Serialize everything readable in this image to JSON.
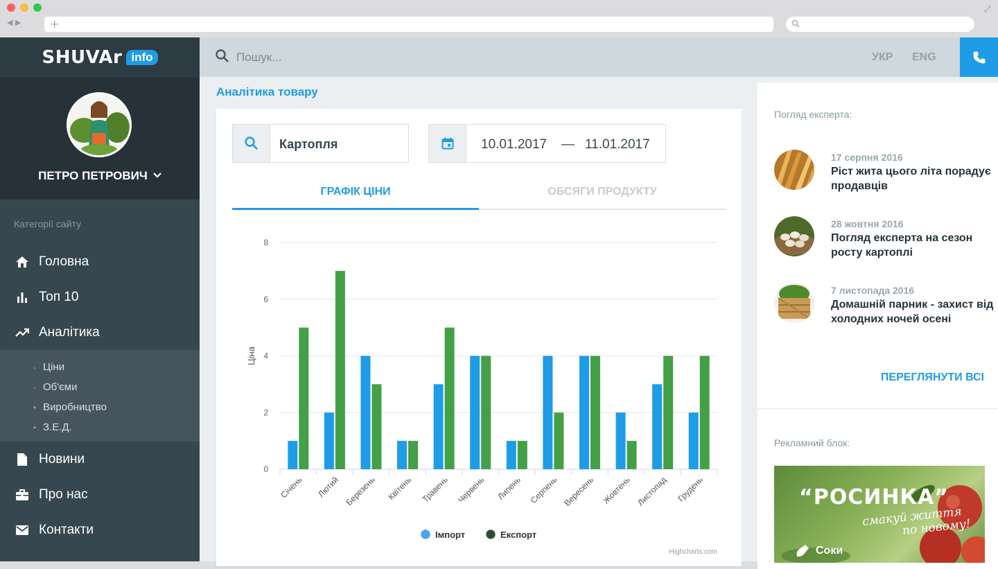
{
  "header": {
    "search_placeholder": "Пошук...",
    "lang_uk": "УКР",
    "lang_en": "ENG"
  },
  "sidebar": {
    "logo_text": "SHUVAr",
    "logo_badge": "info",
    "user_name": "ПЕТРО ПЕТРОВИЧ",
    "categories_label": "Категорії сайту",
    "items": [
      {
        "label": "Головна",
        "icon": "home-icon"
      },
      {
        "label": "Топ 10",
        "icon": "bar-chart-icon"
      },
      {
        "label": "Аналітика",
        "icon": "trending-up-icon"
      }
    ],
    "subitems": [
      {
        "label": "Ціни"
      },
      {
        "label": "Об'єми"
      },
      {
        "label": "Виробництво"
      },
      {
        "label": "З.Е.Д."
      }
    ],
    "items_after": [
      {
        "label": "Новини",
        "icon": "document-icon"
      },
      {
        "label": "Про нас",
        "icon": "briefcase-icon"
      },
      {
        "label": "Контакти",
        "icon": "mail-icon"
      }
    ]
  },
  "main": {
    "page_title": "Аналітика товару",
    "product": "Картопля",
    "date_from": "10.01.2017",
    "date_sep": "—",
    "date_to": "11.01.2017",
    "tabs": [
      {
        "label": "ГРАФІК ЦІНИ",
        "active": true
      },
      {
        "label": "ОБСЯГИ ПРОДУКТУ",
        "active": false
      }
    ],
    "credit": "Highcharts.com"
  },
  "chart_data": {
    "type": "bar",
    "categories": [
      "Січень",
      "Лютий",
      "Березень",
      "Квітень",
      "Травень",
      "Червень",
      "Липень",
      "Серпень",
      "Вересень",
      "Жовтень",
      "Листопад",
      "Грудень"
    ],
    "series": [
      {
        "name": "Імпорт",
        "color": "#1e9ce6",
        "values": [
          1,
          2,
          4,
          1,
          3,
          4,
          1,
          4,
          4,
          2,
          3,
          2
        ]
      },
      {
        "name": "Експорт",
        "color": "#43a047",
        "values": [
          5,
          7,
          3,
          1,
          5,
          4,
          1,
          2,
          4,
          1,
          4,
          4
        ]
      }
    ],
    "ylabel": "Ціна",
    "ylim": [
      0,
      8
    ],
    "yticks": [
      0,
      2,
      4,
      6,
      8
    ],
    "legend": "bottom",
    "grid": true
  },
  "right": {
    "expert_label": "Погляд експерта:",
    "articles": [
      {
        "date": "17 серпня 2016",
        "title": "Ріст жита цього літа порадує продавців"
      },
      {
        "date": "28 жовтня 2016",
        "title": "Погляд експерта на сезон росту картоплі"
      },
      {
        "date": "7 листопада 2016",
        "title": "Домашній парник - захист від холодних ночей осені"
      }
    ],
    "view_all": "ПЕРЕГЛЯНУТИ ВСІ",
    "ad_label": "Рекламний блок:",
    "ad": {
      "title": "“РОСИНКА”",
      "slogan_line1": "смакуй життя",
      "slogan_line2": "по новому!",
      "juice": "Соки"
    }
  }
}
